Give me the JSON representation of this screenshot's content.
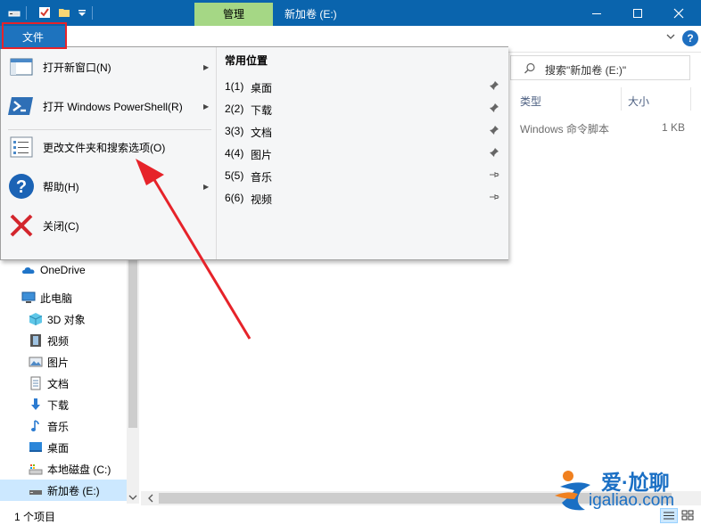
{
  "titlebar": {
    "manage_tab": "管理",
    "window_title": "新加卷 (E:)",
    "bg_color": "#0a64ad"
  },
  "file_tab": {
    "label": "文件",
    "annotation_color": "#e6232a"
  },
  "search": {
    "placeholder": "搜索\"新加卷 (E:)\""
  },
  "columns": {
    "type": "类型",
    "size": "大小"
  },
  "file_row": {
    "type": "Windows 命令脚本",
    "size": "1 KB"
  },
  "file_menu": {
    "items": [
      {
        "label": "打开新窗口(N)",
        "icon": "new-window-icon",
        "has_submenu": true
      },
      {
        "label": "打开 Windows PowerShell(R)",
        "icon": "powershell-icon",
        "has_submenu": true
      },
      {
        "label": "更改文件夹和搜索选项(O)",
        "icon": "folder-options-icon",
        "has_submenu": false
      },
      {
        "label": "帮助(H)",
        "icon": "help-icon",
        "has_submenu": true
      },
      {
        "label": "关闭(C)",
        "icon": "close-x-icon",
        "has_submenu": false
      }
    ],
    "recent": {
      "title": "常用位置",
      "items": [
        {
          "num": "1(1)",
          "name": "桌面",
          "pinned": true
        },
        {
          "num": "2(2)",
          "name": "下载",
          "pinned": true
        },
        {
          "num": "3(3)",
          "name": "文档",
          "pinned": true
        },
        {
          "num": "4(4)",
          "name": "图片",
          "pinned": true
        },
        {
          "num": "5(5)",
          "name": "音乐",
          "pinned": false
        },
        {
          "num": "6(6)",
          "name": "视频",
          "pinned": false
        }
      ]
    }
  },
  "nav": {
    "items": [
      {
        "label": "OneDrive",
        "icon": "onedrive-icon"
      },
      {
        "label": "此电脑",
        "icon": "this-pc-icon"
      },
      {
        "label": "3D 对象",
        "icon": "3d-objects-icon"
      },
      {
        "label": "视频",
        "icon": "videos-icon"
      },
      {
        "label": "图片",
        "icon": "pictures-icon"
      },
      {
        "label": "文档",
        "icon": "documents-icon"
      },
      {
        "label": "下载",
        "icon": "downloads-icon"
      },
      {
        "label": "音乐",
        "icon": "music-icon"
      },
      {
        "label": "桌面",
        "icon": "desktop-icon"
      },
      {
        "label": "本地磁盘 (C:)",
        "icon": "local-disk-icon"
      },
      {
        "label": "新加卷 (E:)",
        "icon": "drive-icon"
      }
    ]
  },
  "statusbar": {
    "text": "1 个项目"
  },
  "watermark": {
    "line1": "爱·尬聊",
    "line2": "igaliao.com"
  }
}
